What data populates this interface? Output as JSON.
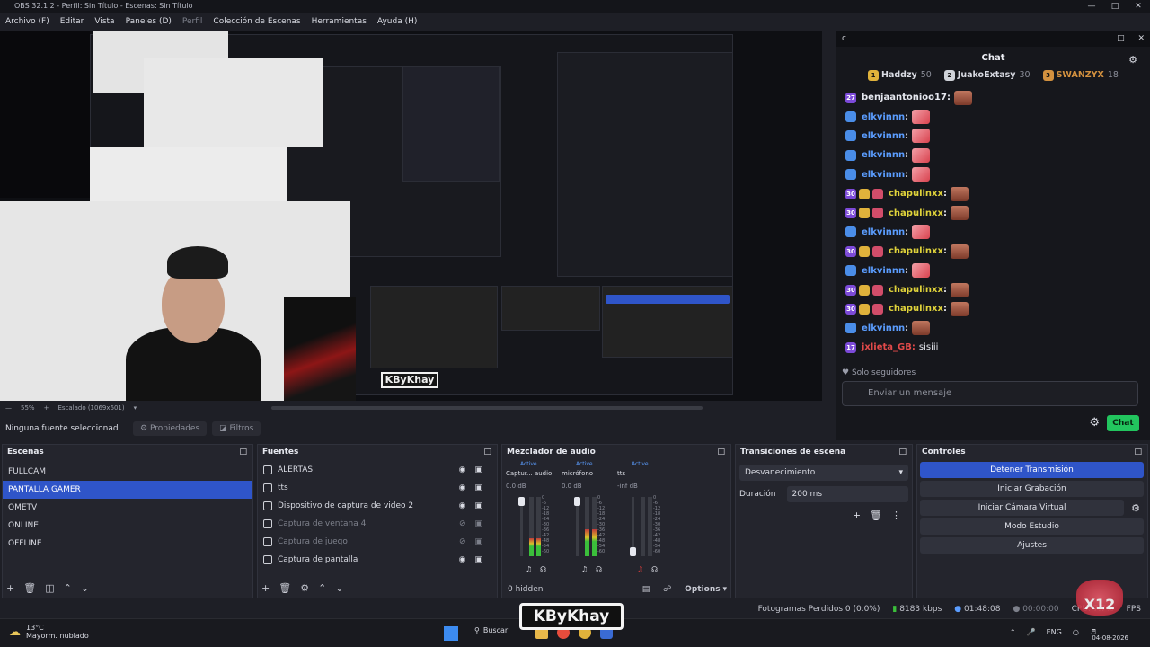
{
  "window": {
    "title": "OBS 32.1.2 - Perfil: Sin Título - Escenas: Sin Título"
  },
  "menu": [
    "Archivo (F)",
    "Editar",
    "Vista",
    "Paneles (D)",
    "Perfil",
    "Colección de Escenas",
    "Herramientas",
    "Ayuda (H)"
  ],
  "chat": {
    "panel_title": "c",
    "title": "Chat",
    "leaders": [
      {
        "rank": "1",
        "name": "Haddzy",
        "count": "50"
      },
      {
        "rank": "2",
        "name": "JuakoExtasy",
        "count": "30"
      },
      {
        "rank": "3",
        "name": "SWANZYX",
        "count": "18"
      }
    ],
    "messages": [
      {
        "user": "benjaantonioo17:",
        "badge": "27",
        "color": "#e6e8ef",
        "emote": "face",
        "text": ""
      },
      {
        "user": "elkvinnn",
        "badge": "",
        "color": "#5b9dff",
        "emote": "pink",
        "text": ""
      },
      {
        "user": "elkvinnn",
        "badge": "",
        "color": "#5b9dff",
        "emote": "pink",
        "text": ""
      },
      {
        "user": "elkvinnn",
        "badge": "",
        "color": "#5b9dff",
        "emote": "pink",
        "text": ""
      },
      {
        "user": "elkvinnn",
        "badge": "",
        "color": "#5b9dff",
        "emote": "pink",
        "text": ""
      },
      {
        "user": "chapulinxx",
        "badge": "30",
        "color": "#e0d33b",
        "emote": "face",
        "text": ""
      },
      {
        "user": "chapulinxx",
        "badge": "30",
        "color": "#e0d33b",
        "emote": "face",
        "text": ""
      },
      {
        "user": "elkvinnn",
        "badge": "",
        "color": "#5b9dff",
        "emote": "pink",
        "text": ""
      },
      {
        "user": "chapulinxx",
        "badge": "30",
        "color": "#e0d33b",
        "emote": "face",
        "text": ""
      },
      {
        "user": "elkvinnn",
        "badge": "",
        "color": "#5b9dff",
        "emote": "pink",
        "text": ""
      },
      {
        "user": "chapulinxx",
        "badge": "30",
        "color": "#e0d33b",
        "emote": "face",
        "text": ""
      },
      {
        "user": "chapulinxx",
        "badge": "30",
        "color": "#e0d33b",
        "emote": "face",
        "text": ""
      },
      {
        "user": "elkvinnn",
        "badge": "",
        "color": "#5b9dff",
        "emote": "face",
        "text": ""
      },
      {
        "user": "jxlieta_GB:",
        "badge": "17",
        "color": "#e24a4a",
        "emote": "",
        "text": "sisiii"
      }
    ],
    "mode": "Solo seguidores",
    "input_placeholder": "Enviar un mensaje",
    "send_label": "Chat"
  },
  "preview": {
    "zoom": "55%",
    "scale": "Escalado (1069x601)"
  },
  "source_bar": {
    "none_selected": "Ninguna fuente seleccionad",
    "properties": "Propiedades",
    "filters": "Filtros"
  },
  "scenes": {
    "title": "Escenas",
    "items": [
      "FULLCAM",
      "PANTALLA GAMER",
      "OMETV",
      "ONLINE",
      "OFFLINE"
    ],
    "selected": 1
  },
  "sources": {
    "title": "Fuentes",
    "items": [
      "ALERTAS",
      "tts",
      "Dispositivo de captura de video 2",
      "Captura de ventana 4",
      "Captura de juego",
      "Captura de pantalla"
    ]
  },
  "mixer": {
    "title": "Mezclador de audio",
    "channels": [
      {
        "status": "Active",
        "name": "Captur... audio",
        "db": "0.0 dB"
      },
      {
        "status": "Active",
        "name": "micrófono",
        "db": "0.0 dB"
      },
      {
        "status": "Active",
        "name": "tts",
        "db": "-inf dB"
      }
    ],
    "scale": [
      "0",
      "-6",
      "-12",
      "-18",
      "-24",
      "-30",
      "-36",
      "-42",
      "-48",
      "-54",
      "-60"
    ],
    "hidden": "0 hidden",
    "options": "Options"
  },
  "transitions": {
    "title": "Transiciones de escena",
    "type": "Desvanecimiento",
    "duration_label": "Duración",
    "duration": "200 ms"
  },
  "controls": {
    "title": "Controles",
    "buttons": [
      "Detener Transmisión",
      "Iniciar Grabación",
      "Iniciar Cámara Virtual",
      "Modo Estudio",
      "Ajustes"
    ]
  },
  "status": {
    "dropped": "Fotogramas Perdidos 0 (0.0%)",
    "bitrate": "8183 kbps",
    "live": "01:48:08",
    "rec": "00:00:00",
    "cpu": "CPU: 7.7%",
    "fps": "FPS"
  },
  "taskbar": {
    "temp": "13°C",
    "weather": "Mayorm. nublado",
    "search": "Buscar",
    "lang": "ENG",
    "date": "04-08-2026"
  },
  "overlay": {
    "logo": "KByKhay",
    "badge": "X12"
  },
  "colors": {
    "accent": "#2f55c9",
    "chat_button": "#22c55e",
    "bg": "#1e1f26"
  }
}
